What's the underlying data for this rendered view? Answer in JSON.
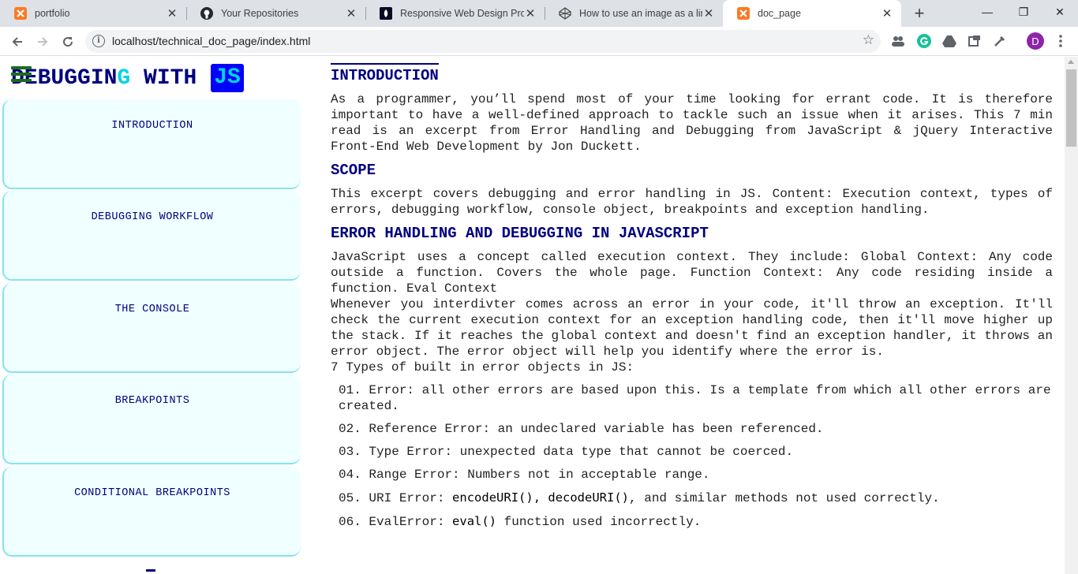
{
  "browser": {
    "tabs": [
      {
        "title": "portfolio",
        "icon": "xampp-icon",
        "active": false
      },
      {
        "title": "Your Repositories",
        "icon": "github-icon",
        "active": false
      },
      {
        "title": "Responsive Web Design Projec",
        "icon": "freecodecamp-icon",
        "active": false
      },
      {
        "title": "How to use an image as a link",
        "icon": "codepen-icon",
        "active": false
      },
      {
        "title": "doc_page",
        "icon": "xampp-icon",
        "active": true
      }
    ],
    "new_tab_label": "+",
    "window_controls": {
      "minimize": "—",
      "maximize": "❐",
      "close": "✕"
    },
    "address": "localhost/technical_doc_page/index.html",
    "profile_initial": "D",
    "colors": {
      "profile": "#8e24aa",
      "grammarly": "#15c39a",
      "xampp": "#fb7a24"
    }
  },
  "page": {
    "logo": {
      "part1": "DEBUGGIN",
      "part2": "G",
      "part3": " WITH",
      "badge": "JS"
    },
    "nav_items": [
      "INTRODUCTION",
      "DEBUGGING WORKFLOW",
      "THE CONSOLE",
      "BREAKPOINTS",
      "CONDITIONAL BREAKPOINTS"
    ],
    "sections": {
      "introduction": {
        "heading": "INTRODUCTION",
        "text": "As a programmer, you’ll spend most of your time looking for errant code. It is therefore important to have a well-defined approach to tackle such an issue when it arises. This 7 min read is an excerpt from Error Handling and Debugging from JavaScript & jQuery Interactive Front-End Web Development by Jon Duckett."
      },
      "scope": {
        "heading": "SCOPE",
        "text": "This excerpt covers debugging and error handling in JS. Content: Execution context, types of errors, debugging workflow, console object, breakpoints and exception handling."
      },
      "error_handling": {
        "heading": "ERROR HANDLING AND DEBUGGING IN JAVASCRIPT",
        "text1": "JavaScript uses a concept called execution context. They include: Global Context: Any code outside a function. Covers the whole page. Function Context: Any code residing inside a function. Eval Context",
        "text2": "Whenever you interdivter comes across an error in your code, it'll throw an exception. It'll check the current execution context for an exception handling code, then it'll move higher up the stack. If it reaches the global context and doesn't find an exception handler, it throws an error object. The error object will help you identify where the error is.",
        "types_intro": "7 Types of built in error objects in JS:",
        "types": [
          {
            "num": "01.",
            "pre": "Error: all other errors are based upon this. Is a template from which all other errors are created.",
            "code": "",
            "post": ""
          },
          {
            "num": "02.",
            "pre": "Reference Error: an undeclared variable has been referenced.",
            "code": "",
            "post": ""
          },
          {
            "num": "03.",
            "pre": "Type Error: unexpected data type that cannot be coerced.",
            "code": "",
            "post": ""
          },
          {
            "num": "04.",
            "pre": "Range Error: Numbers not in acceptable range.",
            "code": "",
            "post": ""
          },
          {
            "num": "05.",
            "pre": "URI Error: ",
            "code": "encodeURI(), decodeURI()",
            "post": ", and similar methods not used correctly."
          },
          {
            "num": "06.",
            "pre": "EvalError: ",
            "code": "eval()",
            "post": " function used incorrectly."
          }
        ]
      }
    }
  }
}
